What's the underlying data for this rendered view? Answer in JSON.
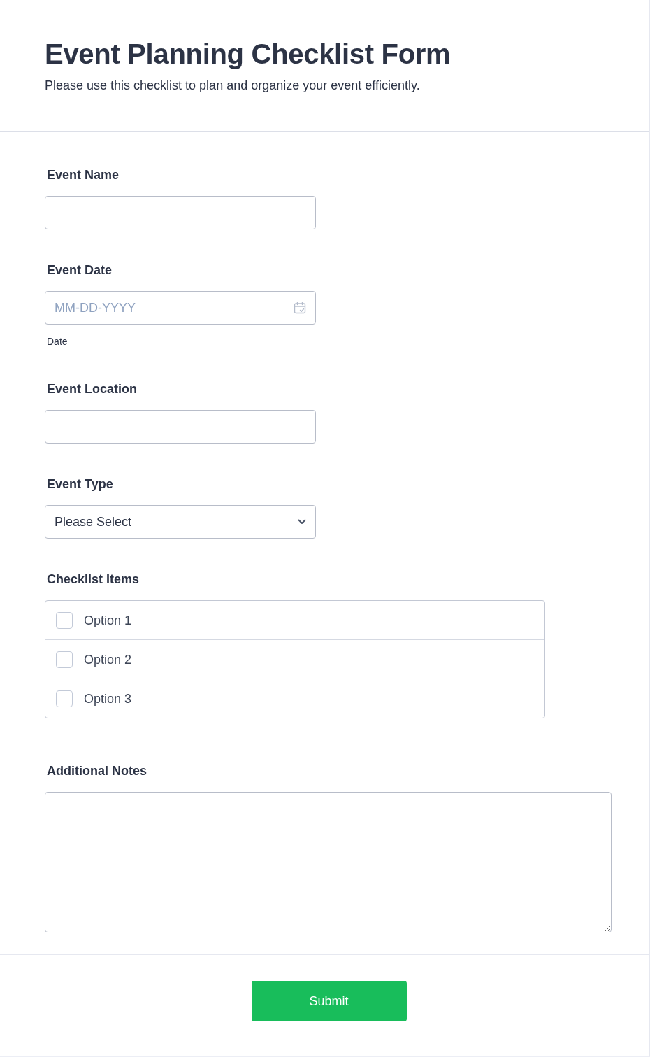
{
  "header": {
    "title": "Event Planning Checklist Form",
    "subtitle": "Please use this checklist to plan and organize your event efficiently."
  },
  "fields": [
    {
      "kind": "text",
      "label": "Event Name"
    },
    {
      "kind": "date",
      "label": "Event Date",
      "placeholder": "MM-DD-YYYY",
      "sublabel": "Date"
    },
    {
      "kind": "text",
      "label": "Event Location"
    },
    {
      "kind": "select",
      "label": "Event Type",
      "value": "Please Select"
    },
    {
      "kind": "checklist",
      "label": "Checklist Items",
      "options": [
        {
          "label": "Option 1",
          "checked": false
        },
        {
          "label": "Option 2",
          "checked": false
        },
        {
          "label": "Option 3",
          "checked": false
        }
      ]
    },
    {
      "kind": "textarea",
      "label": "Additional Notes"
    }
  ],
  "submit": {
    "label": "Submit"
  }
}
